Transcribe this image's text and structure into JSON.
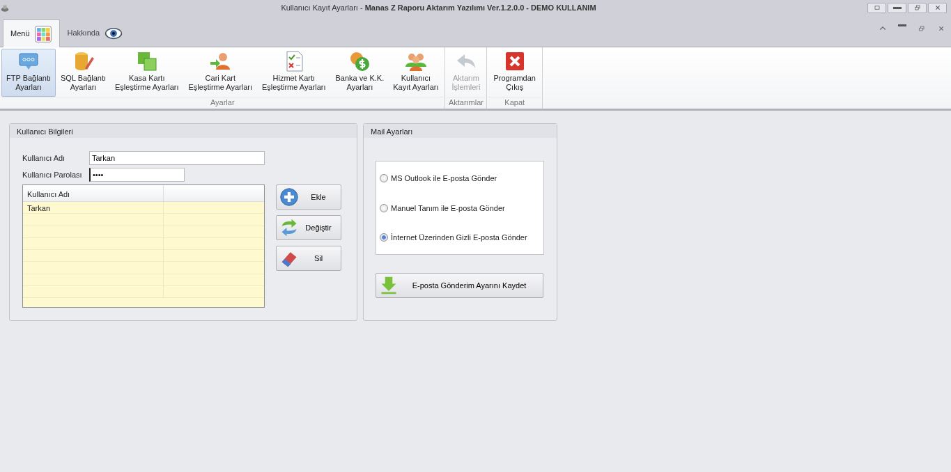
{
  "window": {
    "title_regular": "Kullanıcı Kayıt Ayarları - ",
    "title_bold": "Manas Z Raporu Aktarım Yazılımı Ver.1.2.0.0 - DEMO KULLANIM"
  },
  "tabs": [
    {
      "label": "Menü",
      "selected": true
    },
    {
      "label": "Hakkında",
      "selected": false
    }
  ],
  "ribbon_groups": [
    {
      "label": "Ayarlar",
      "buttons": [
        {
          "label": "FTP Bağlantı Ayarları",
          "selected": true,
          "disabled": false
        },
        {
          "label": "SQL Bağlantı Ayarları",
          "selected": false,
          "disabled": false
        },
        {
          "label": "Kasa Kartı Eşleştirme Ayarları",
          "selected": false,
          "disabled": false
        },
        {
          "label": "Cari Kart Eşleştirme Ayarları",
          "selected": false,
          "disabled": false
        },
        {
          "label": "Hizmet Kartı Eşleştirme Ayarları",
          "selected": false,
          "disabled": false
        },
        {
          "label": "Banka ve K.K. Ayarları",
          "selected": false,
          "disabled": false
        },
        {
          "label": "Kullanıcı Kayıt Ayarları",
          "selected": false,
          "disabled": false
        }
      ]
    },
    {
      "label": "Aktarımlar",
      "buttons": [
        {
          "label": "Aktarım İşlemleri",
          "selected": false,
          "disabled": true
        }
      ]
    },
    {
      "label": "Kapat",
      "buttons": [
        {
          "label": "Programdan Çıkış",
          "selected": false,
          "disabled": false
        }
      ]
    }
  ],
  "user_panel": {
    "title": "Kullanıcı Bilgileri",
    "fields": [
      {
        "label": "Kullanıcı Adı",
        "value": "Tarkan"
      },
      {
        "label": "Kullanıcı Parolası",
        "value": "••••"
      }
    ],
    "table": {
      "columns": [
        "Kullanıcı Adı"
      ],
      "rows": [
        {
          "kullanici_adi": "Tarkan"
        }
      ]
    },
    "buttons": [
      "Ekle",
      "Değiştir",
      "Sil"
    ]
  },
  "mail_panel": {
    "title": "Mail Ayarları",
    "options": [
      {
        "label": "MS Outlook ile E-posta Gönder",
        "selected": false
      },
      {
        "label": "Manuel Tanım ile E-posta Gönder",
        "selected": false
      },
      {
        "label": "İnternet Üzerinden Gizli E-posta Gönder",
        "selected": true
      }
    ],
    "save_button": "E-posta Gönderim Ayarını Kaydet"
  }
}
